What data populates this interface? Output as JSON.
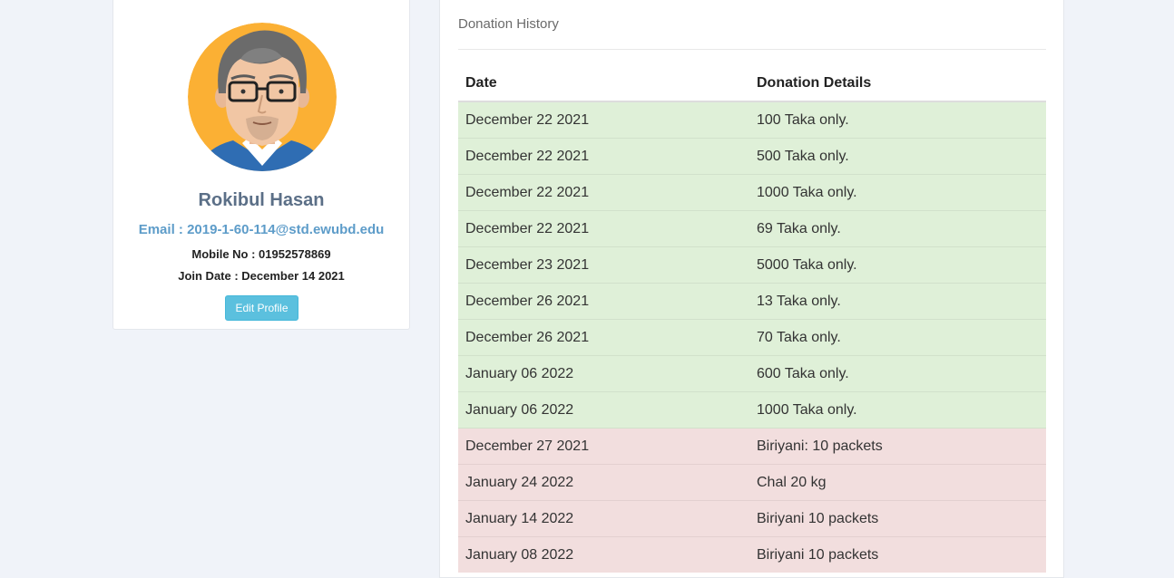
{
  "colors": {
    "page_bg": "#f0f3f9",
    "name": "#5b6f87",
    "email": "#5d9cc9",
    "button": "#5bc0de",
    "money_row": "#dff0d8",
    "food_row": "#f2dede"
  },
  "profile": {
    "avatar_icon": "man-with-glasses-avatar",
    "name": "Rokibul Hasan",
    "email": "Email : 2019-1-60-114@std.ewubd.edu",
    "mobile": "Mobile No : 01952578869",
    "join_date": "Join Date : December 14 2021",
    "edit_label": "Edit Profile"
  },
  "history": {
    "title": "Donation History",
    "columns": {
      "date": "Date",
      "details": "Donation Details"
    },
    "rows": [
      {
        "date": "December 22 2021",
        "details": "100 Taka only.",
        "kind": "money"
      },
      {
        "date": "December 22 2021",
        "details": "500 Taka only.",
        "kind": "money"
      },
      {
        "date": "December 22 2021",
        "details": "1000 Taka only.",
        "kind": "money"
      },
      {
        "date": "December 22 2021",
        "details": "69 Taka only.",
        "kind": "money"
      },
      {
        "date": "December 23 2021",
        "details": "5000 Taka only.",
        "kind": "money"
      },
      {
        "date": "December 26 2021",
        "details": "13 Taka only.",
        "kind": "money"
      },
      {
        "date": "December 26 2021",
        "details": "70 Taka only.",
        "kind": "money"
      },
      {
        "date": "January 06 2022",
        "details": "600 Taka only.",
        "kind": "money"
      },
      {
        "date": "January 06 2022",
        "details": "1000 Taka only.",
        "kind": "money"
      },
      {
        "date": "December 27 2021",
        "details": "Biriyani: 10 packets",
        "kind": "food"
      },
      {
        "date": "January 24 2022",
        "details": "Chal 20 kg",
        "kind": "food"
      },
      {
        "date": "January 14 2022",
        "details": "Biriyani 10 packets",
        "kind": "food"
      },
      {
        "date": "January 08 2022",
        "details": "Biriyani 10 packets",
        "kind": "food"
      }
    ]
  }
}
